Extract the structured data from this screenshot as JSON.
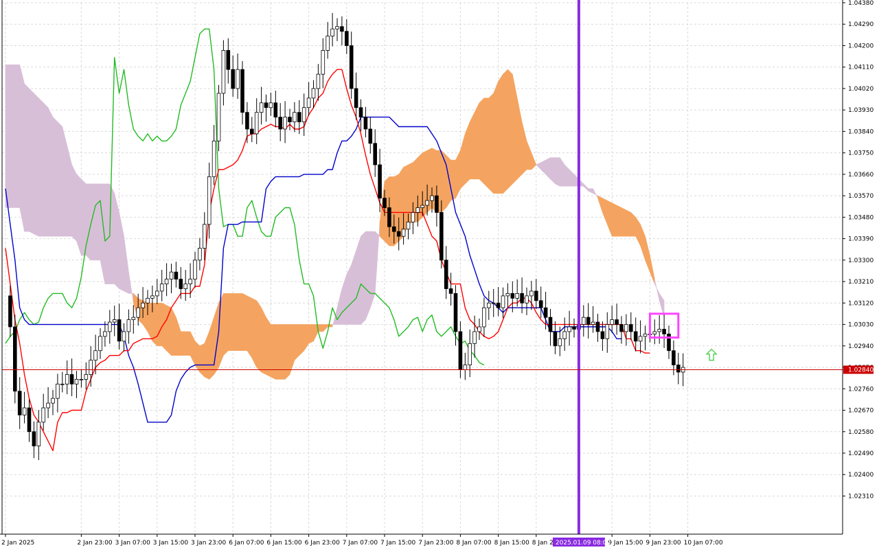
{
  "chart_data": {
    "type": "candlestick",
    "instrument_indicators": [
      "ichimoku"
    ],
    "grid": true,
    "y_axis": {
      "position": "right",
      "ylim": [
        1.0215,
        1.0438
      ],
      "ticks": [
        "1.04380",
        "1.04290",
        "1.04200",
        "1.04110",
        "1.04020",
        "1.03930",
        "1.03840",
        "1.03750",
        "1.03660",
        "1.03570",
        "1.03480",
        "1.03390",
        "1.03300",
        "1.03210",
        "1.03120",
        "1.03030",
        "1.02940",
        "1.02850",
        "1.02760",
        "1.02670",
        "1.02580",
        "1.02490",
        "1.02400",
        "1.02310"
      ],
      "current_price_label": "1.02840",
      "current_price": 1.0284
    },
    "x_axis": {
      "ticks": [
        {
          "label": "2 Jan 2025",
          "bar": 0
        },
        {
          "label": "2 Jan 23:00",
          "bar": 16
        },
        {
          "label": "3 Jan 07:00",
          "bar": 24
        },
        {
          "label": "3 Jan 15:00",
          "bar": 32
        },
        {
          "label": "3 Jan 23:00",
          "bar": 40
        },
        {
          "label": "6 Jan 07:00",
          "bar": 48
        },
        {
          "label": "6 Jan 15:00",
          "bar": 56
        },
        {
          "label": "6 Jan 23:00",
          "bar": 64
        },
        {
          "label": "7 Jan 07:00",
          "bar": 72
        },
        {
          "label": "7 Jan 15:00",
          "bar": 80
        },
        {
          "label": "7 Jan 23:00",
          "bar": 88
        },
        {
          "label": "8 Jan 07:00",
          "bar": 96
        },
        {
          "label": "8 Jan 15:00",
          "bar": 104
        },
        {
          "label": "8 Jan 23:00",
          "bar": 112
        },
        {
          "label": "9 Jan 15:00",
          "bar": 128
        },
        {
          "label": "9 Jan 23:00",
          "bar": 136
        },
        {
          "label": "10 Jan 07:00",
          "bar": 144
        }
      ],
      "highlight_label": {
        "label": "2025.01.09 08:00",
        "bar": 121
      }
    },
    "close": [
      1.0315,
      1.0302,
      1.0275,
      1.0265,
      1.0268,
      1.0258,
      1.0252,
      1.0262,
      1.0268,
      1.027,
      1.0272,
      1.0278,
      1.0278,
      1.0282,
      1.0278,
      1.028,
      1.028,
      1.0282,
      1.0288,
      1.0292,
      1.0298,
      1.03,
      1.0304,
      1.0305,
      1.0296,
      1.03,
      1.0305,
      1.0306,
      1.031,
      1.0312,
      1.0314,
      1.0315,
      1.0317,
      1.032,
      1.0322,
      1.0325,
      1.0322,
      1.0318,
      1.032,
      1.0322,
      1.033,
      1.0335,
      1.0345,
      1.0365,
      1.038,
      1.04,
      1.0418,
      1.041,
      1.0402,
      1.041,
      1.0392,
      1.0385,
      1.0383,
      1.0392,
      1.0396,
      1.0394,
      1.0396,
      1.039,
      1.0385,
      1.039,
      1.0388,
      1.0392,
      1.0388,
      1.0394,
      1.0398,
      1.0402,
      1.0408,
      1.0418,
      1.0424,
      1.0427,
      1.0428,
      1.0426,
      1.042,
      1.0402,
      1.0394,
      1.039,
      1.0385,
      1.0379,
      1.037,
      1.0356,
      1.0352,
      1.0344,
      1.0342,
      1.034,
      1.0343,
      1.0346,
      1.035,
      1.0352,
      1.0353,
      1.0355,
      1.0357,
      1.035,
      1.033,
      1.0318,
      1.0316,
      1.03,
      1.0284,
      1.0286,
      1.0295,
      1.03,
      1.0302,
      1.031,
      1.0312,
      1.0312,
      1.031,
      1.0315,
      1.0316,
      1.0314,
      1.0316,
      1.0312,
      1.0315,
      1.0317,
      1.0313,
      1.031,
      1.0306,
      1.03,
      1.0294,
      1.0297,
      1.03,
      1.0302,
      1.0301,
      1.0303,
      1.0306,
      1.0303,
      1.0304,
      1.03,
      1.0297,
      1.0303,
      1.0305,
      1.0303,
      1.03,
      1.0303,
      1.03,
      1.0296,
      1.0298,
      1.0299,
      1.0299,
      1.03,
      1.0301,
      1.0299,
      1.0292,
      1.0286,
      1.0283,
      1.0285
    ],
    "candle_range": {
      "start_bar": 0,
      "end_bar": 147
    },
    "lines": [
      {
        "name": "Tenkan-sen",
        "color": "#ff0000"
      },
      {
        "name": "Kijun-sen",
        "color": "#0000cc"
      },
      {
        "name": "Chikou Span",
        "color": "#22bb22"
      }
    ],
    "tenkan": [
      1.0335,
      1.032,
      1.0305,
      1.0295,
      1.0282,
      1.0272,
      1.0265,
      1.0262,
      1.0258,
      1.0254,
      1.025,
      1.0262,
      1.0266,
      1.0266,
      1.0267,
      1.0267,
      1.0267,
      1.0275,
      1.028,
      1.0285,
      1.0287,
      1.0288,
      1.029,
      1.029,
      1.029,
      1.0292,
      1.0292,
      1.0295,
      1.0296,
      1.0297,
      1.0297,
      1.0297,
      1.0298,
      1.0302,
      1.0305,
      1.031,
      1.0313,
      1.0316,
      1.0316,
      1.0316,
      1.0319,
      1.0319,
      1.0328,
      1.035,
      1.036,
      1.0368,
      1.0368,
      1.0369,
      1.037,
      1.0372,
      1.0376,
      1.0382,
      1.0383,
      1.0383,
      1.0385,
      1.0386,
      1.0387,
      1.0386,
      1.0386,
      1.0385,
      1.0387,
      1.0385,
      1.0385,
      1.0386,
      1.0391,
      1.0394,
      1.0398,
      1.04,
      1.0405,
      1.0408,
      1.041,
      1.041,
      1.0402,
      1.0395,
      1.039,
      1.0383,
      1.0374,
      1.0366,
      1.036,
      1.0354,
      1.035,
      1.035,
      1.035,
      1.035,
      1.035,
      1.035,
      1.035,
      1.035,
      1.035,
      1.0345,
      1.034,
      1.0338,
      1.033,
      1.0325,
      1.032,
      1.032,
      1.032,
      1.031,
      1.0305,
      1.0303,
      1.03,
      1.0298,
      1.0297,
      1.0298,
      1.03,
      1.0305,
      1.031,
      1.0312,
      1.0312,
      1.0314,
      1.0314,
      1.0312,
      1.0308,
      1.0305,
      1.0303,
      1.0303,
      1.0303,
      1.0303,
      1.0303,
      1.0303,
      1.0303,
      1.0303,
      1.0303,
      1.0303,
      1.0303,
      1.0303,
      1.0303,
      1.0303,
      1.0303,
      1.0303,
      1.0303,
      1.0297,
      1.0297,
      1.0292,
      1.0292,
      1.0291,
      1.0291
    ],
    "tenkan_start_bar": 0,
    "kijun": [
      1.036,
      1.0345,
      1.033,
      1.031,
      1.0305,
      1.0303,
      1.0303,
      1.0303,
      1.0303,
      1.0303,
      1.0303,
      1.0303,
      1.0303,
      1.0303,
      1.0303,
      1.0303,
      1.0303,
      1.0303,
      1.0303,
      1.0303,
      1.0303,
      1.0303,
      1.0303,
      1.0303,
      1.0303,
      1.0298,
      1.029,
      1.0285,
      1.0278,
      1.027,
      1.0262,
      1.0262,
      1.0262,
      1.0262,
      1.0262,
      1.0265,
      1.0275,
      1.028,
      1.0283,
      1.0285,
      1.0286,
      1.0286,
      1.0286,
      1.0286,
      1.0286,
      1.03,
      1.0335,
      1.0345,
      1.0345,
      1.0345,
      1.0346,
      1.0346,
      1.0346,
      1.0346,
      1.0346,
      1.036,
      1.0363,
      1.0365,
      1.0365,
      1.0365,
      1.0365,
      1.0365,
      1.0365,
      1.0366,
      1.0366,
      1.0366,
      1.0366,
      1.0366,
      1.0368,
      1.0368,
      1.0375,
      1.038,
      1.038,
      1.0382,
      1.0385,
      1.039,
      1.039,
      1.039,
      1.039,
      1.039,
      1.039,
      1.039,
      1.0388,
      1.0386,
      1.0386,
      1.0386,
      1.0386,
      1.0386,
      1.0386,
      1.0386,
      1.0383,
      1.038,
      1.0375,
      1.037,
      1.036,
      1.035,
      1.0345,
      1.034,
      1.0332,
      1.0326,
      1.032,
      1.0315,
      1.0313,
      1.0312,
      1.031,
      1.0308,
      1.031,
      1.031,
      1.031,
      1.031,
      1.031,
      1.031,
      1.031,
      1.031,
      1.0305,
      1.03,
      1.03,
      1.03,
      1.0302,
      1.0302,
      1.0302,
      1.0302,
      1.0302,
      1.0302,
      1.0302,
      1.0302,
      1.0302,
      1.0302,
      1.03,
      1.0297,
      1.0297
    ],
    "kijun_start_bar": 0,
    "chikou": [
      1.0295,
      1.0298,
      1.03,
      1.0305,
      1.0308,
      1.0305,
      1.0303,
      1.0304,
      1.031,
      1.0314,
      1.0316,
      1.0316,
      1.0316,
      1.0312,
      1.031,
      1.0314,
      1.0323,
      1.0336,
      1.0345,
      1.0353,
      1.0355,
      1.0338,
      1.034,
      1.0415,
      1.04,
      1.041,
      1.0395,
      1.0385,
      1.0382,
      1.038,
      1.0383,
      1.038,
      1.0382,
      1.038,
      1.038,
      1.0382,
      1.0385,
      1.0395,
      1.04,
      1.0405,
      1.0415,
      1.0425,
      1.0427,
      1.0427,
      1.041,
      1.036,
      1.0344,
      1.0345,
      1.0345,
      1.034,
      1.034,
      1.0352,
      1.0355,
      1.0348,
      1.0342,
      1.034,
      1.034,
      1.0348,
      1.035,
      1.0352,
      1.0352,
      1.0345,
      1.033,
      1.032,
      1.032,
      1.0315,
      1.03,
      1.0293,
      1.03,
      1.031,
      1.0305,
      1.0308,
      1.031,
      1.0312,
      1.0314,
      1.032,
      1.0318,
      1.0316,
      1.0316,
      1.0314,
      1.0312,
      1.031,
      1.0305,
      1.0298,
      1.03,
      1.0302,
      1.0305,
      1.0306,
      1.03,
      1.0305,
      1.0307,
      1.03,
      1.0298,
      1.03,
      1.0302,
      1.0298,
      1.0295,
      1.0296,
      1.0292,
      1.029,
      1.0287,
      1.0286
    ],
    "chikou_start_bar": 0,
    "kumo": {
      "senkou_a": [
        1.0352,
        1.0352,
        1.0352,
        1.0352,
        1.0342,
        1.0342,
        1.0341,
        1.034,
        1.034,
        1.034,
        1.034,
        1.034,
        1.034,
        1.034,
        1.034,
        1.0338,
        1.0332,
        1.0332,
        1.033,
        1.033,
        1.033,
        1.032,
        1.032,
        1.032,
        1.0318,
        1.0317,
        1.0316,
        1.0316,
        1.0314,
        1.0313,
        1.0312,
        1.0312,
        1.0312,
        1.0312,
        1.0311,
        1.031,
        1.0306,
        1.03,
        1.03,
        1.03,
        1.0296,
        1.0294,
        1.0295,
        1.03,
        1.0306,
        1.0312,
        1.0316,
        1.0316,
        1.0316,
        1.0316,
        1.0316,
        1.0315,
        1.0314,
        1.0313,
        1.031,
        1.0306,
        1.0303,
        1.0303,
        1.0303,
        1.0303,
        1.0303,
        1.0303,
        1.0303,
        1.0303,
        1.0303,
        1.0303,
        1.0303,
        1.0303,
        1.0303,
        1.0303,
        1.0303,
        1.0303,
        1.0303,
        1.0303,
        1.0303,
        1.0303,
        1.0305,
        1.031,
        1.0316,
        1.0346,
        1.0363,
        1.0365,
        1.0365,
        1.0366,
        1.0369,
        1.037,
        1.0371,
        1.0373,
        1.0375,
        1.0376,
        1.0377,
        1.0376,
        1.0376,
        1.0374,
        1.0372,
        1.0372,
        1.0376,
        1.0383,
        1.0388,
        1.0392,
        1.0396,
        1.0398,
        1.0398,
        1.04,
        1.0405,
        1.0408,
        1.041,
        1.0408,
        1.0398,
        1.0388,
        1.038,
        1.0375,
        1.037,
        1.0368,
        1.0366,
        1.0364,
        1.0362,
        1.0361,
        1.0361,
        1.0361,
        1.0361,
        1.0361,
        1.0361,
        1.0359,
        1.0358,
        1.0357,
        1.0356,
        1.0355,
        1.0354,
        1.0353,
        1.0352,
        1.0351,
        1.035,
        1.0348,
        1.0345,
        1.034,
        1.0332,
        1.0322,
        1.0313,
        1.0306
      ],
      "senkou_b": [
        1.0412,
        1.0412,
        1.0412,
        1.0412,
        1.0404,
        1.0402,
        1.04,
        1.0398,
        1.0396,
        1.0394,
        1.039,
        1.0388,
        1.0386,
        1.0378,
        1.037,
        1.0366,
        1.0364,
        1.0362,
        1.0362,
        1.0362,
        1.0362,
        1.0362,
        1.0362,
        1.0358,
        1.035,
        1.034,
        1.0325,
        1.0312,
        1.0305,
        1.0303,
        1.03,
        1.0296,
        1.0294,
        1.0294,
        1.0292,
        1.029,
        1.029,
        1.029,
        1.029,
        1.029,
        1.0286,
        1.0283,
        1.0281,
        1.028,
        1.0282,
        1.0285,
        1.029,
        1.0292,
        1.0292,
        1.0292,
        1.0292,
        1.0292,
        1.0289,
        1.0285,
        1.0283,
        1.0282,
        1.0281,
        1.028,
        1.028,
        1.028,
        1.0282,
        1.0288,
        1.029,
        1.0292,
        1.0295,
        1.0296,
        1.03,
        1.03,
        1.0302,
        1.0302,
        1.031,
        1.0318,
        1.0324,
        1.0328,
        1.0334,
        1.034,
        1.0342,
        1.0342,
        1.0342,
        1.034,
        1.0338,
        1.0336,
        1.0336,
        1.0338,
        1.034,
        1.0345,
        1.0346,
        1.0346,
        1.0348,
        1.035,
        1.0352,
        1.035,
        1.035,
        1.0352,
        1.0355,
        1.0356,
        1.036,
        1.0362,
        1.0364,
        1.0364,
        1.0364,
        1.0362,
        1.036,
        1.0358,
        1.0358,
        1.0358,
        1.036,
        1.0362,
        1.0364,
        1.0366,
        1.0368,
        1.0368,
        1.037,
        1.0371,
        1.0372,
        1.0373,
        1.0373,
        1.0373,
        1.037,
        1.0368,
        1.0366,
        1.0364,
        1.0362,
        1.036,
        1.036,
        1.0356,
        1.035,
        1.0345,
        1.034,
        1.034,
        1.034,
        1.034,
        1.034,
        1.034,
        1.0336,
        1.033,
        1.0325,
        1.032,
        1.0316,
        1.0313,
        1.0312
      ],
      "start_bar": 0,
      "bullish_color": "#f4a460",
      "bearish_color": "#d8bfd8"
    },
    "annotations": [
      {
        "type": "vertical_line",
        "bar": 121,
        "color": "#8a2be2"
      },
      {
        "type": "rectangle",
        "bar_from": 136,
        "bar_to": 142,
        "price_from": 1.02975,
        "price_to": 1.03075,
        "color": "#ff44ff"
      },
      {
        "type": "up_arrow",
        "bar": 149,
        "price": 1.029,
        "color": "#44cc44"
      },
      {
        "type": "horizontal_line",
        "price": 1.0284,
        "color": "#cc0000"
      }
    ]
  }
}
